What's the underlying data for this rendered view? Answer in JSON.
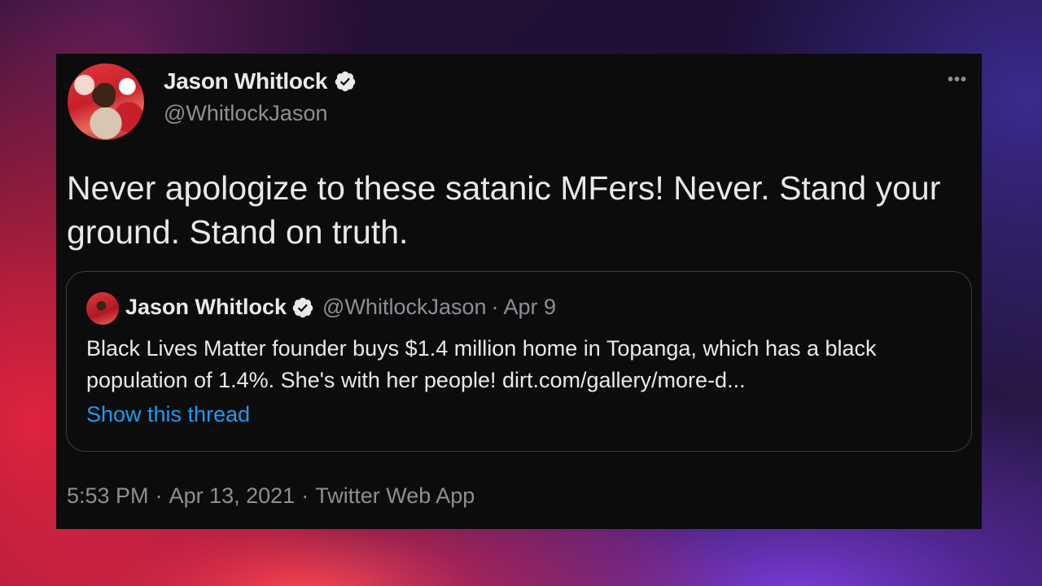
{
  "tweet": {
    "author_name": "Jason Whitlock",
    "author_handle": "@WhitlockJason",
    "text": "Never apologize to these satanic MFers! Never. Stand your ground. Stand on truth.",
    "more_icon": "•••",
    "time": "5:53 PM",
    "date": "Apr 13, 2021",
    "source": "Twitter Web App",
    "separator": "·"
  },
  "quoted_tweet": {
    "author_name": "Jason Whitlock",
    "author_handle": "@WhitlockJason",
    "separator": "·",
    "date": "Apr 9",
    "text": "Black Lives Matter founder buys $1.4 million home in Topanga, which has a black population of 1.4%. She's with her people! dirt.com/gallery/more-d...",
    "show_thread_label": "Show this thread"
  },
  "icons": {
    "verified": "verified-badge-icon",
    "more": "more-options-icon"
  },
  "colors": {
    "card_background": "#0c0c0d",
    "text_primary": "#e7e9ea",
    "text_secondary": "#8b9096",
    "link": "#1d9bf0",
    "border": "#3a3d41"
  }
}
